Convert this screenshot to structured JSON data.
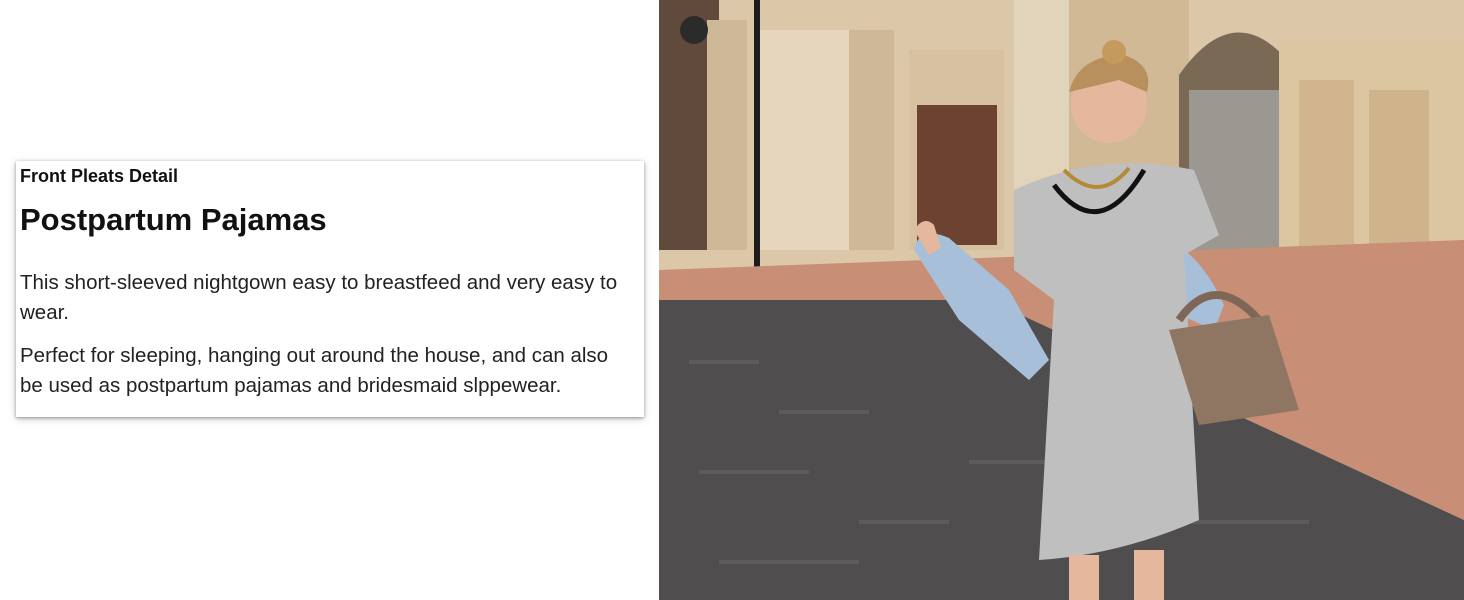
{
  "card": {
    "kicker": "Front Pleats Detail",
    "title": "Postpartum Pajamas",
    "paragraphs": [
      "This short-sleeved nightgown easy to breastfeed and very easy to wear.",
      "Perfect for sleeping, hanging out around the house, and can also be used as postpartum pajamas and bridesmaid slppewear."
    ]
  },
  "photo": {
    "icon": "product-photo-icon",
    "colors": {
      "building": "#d9c3a3",
      "pavement": "#4d4b4b",
      "sidewalk": "#c58a72",
      "dress": "#bdbdbd",
      "jacket": "#a9c0da",
      "bag": "#8b725f"
    }
  }
}
